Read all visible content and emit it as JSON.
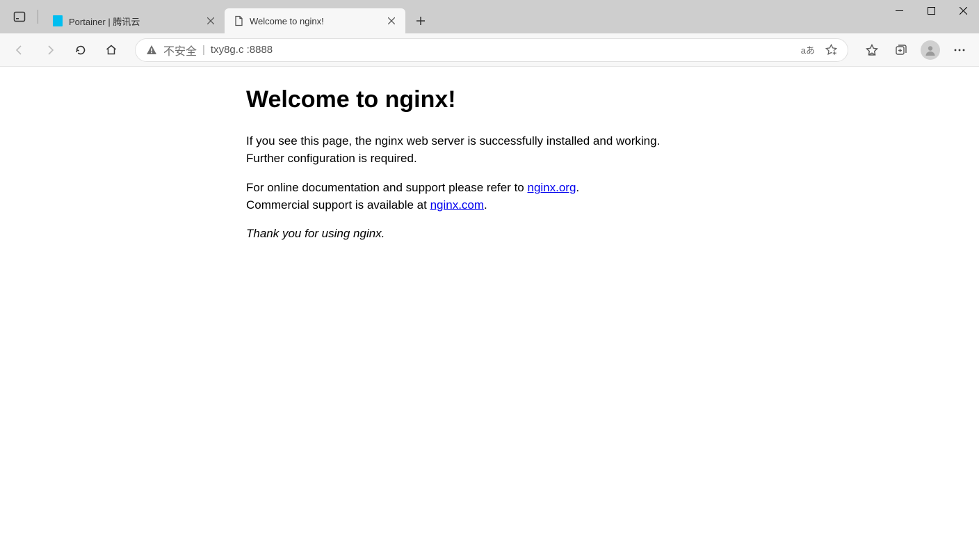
{
  "window": {
    "tabs": [
      {
        "title": "Portainer | 腾讯云",
        "active": false
      },
      {
        "title": "Welcome to nginx!",
        "active": true
      }
    ]
  },
  "addressbar": {
    "insecure_label": "不安全",
    "url_display": "txy8g.c         :8888",
    "translate_label": "aあ"
  },
  "page": {
    "heading": "Welcome to nginx!",
    "paragraph1": "If you see this page, the nginx web server is successfully installed and working. Further configuration is required.",
    "para2_pre": "For online documentation and support please refer to ",
    "link1_text": "nginx.org",
    "para2_mid": ".",
    "para3_pre": "Commercial support is available at ",
    "link2_text": "nginx.com",
    "para3_post": ".",
    "thank_you": "Thank you for using nginx."
  }
}
